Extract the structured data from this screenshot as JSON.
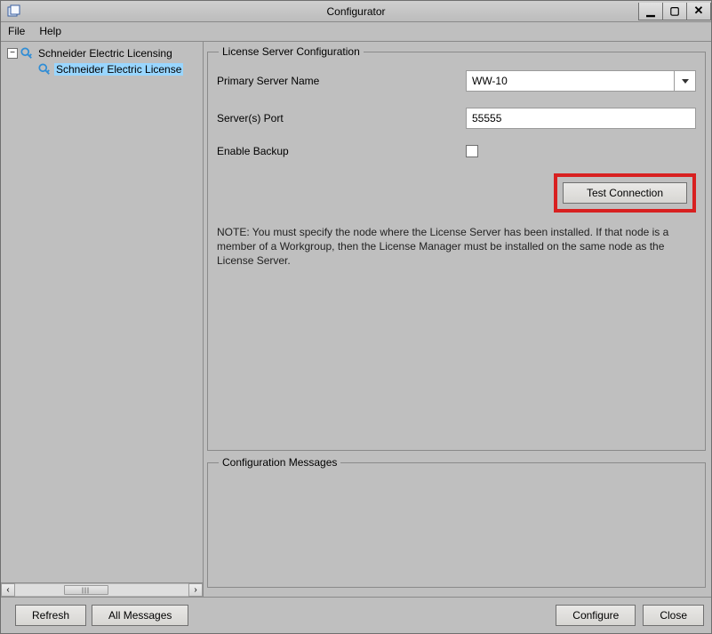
{
  "window": {
    "title": "Configurator"
  },
  "menu": {
    "file": "File",
    "help": "Help"
  },
  "tree": {
    "root_label": "Schneider Electric Licensing",
    "child_label": "Schneider Electric License"
  },
  "config": {
    "group_title": "License Server Configuration",
    "primary_server_label": "Primary Server Name",
    "primary_server_value": "WW-10",
    "port_label": "Server(s) Port",
    "port_value": "55555",
    "backup_label": "Enable Backup",
    "test_button_label": "Test Connection",
    "note": "NOTE: You must specify the node where the License Server has been installed. If that node is a member of a Workgroup, then the License Manager must be installed on the same node as the License Server."
  },
  "messages": {
    "group_title": "Configuration Messages"
  },
  "buttons": {
    "refresh": "Refresh",
    "all_messages": "All Messages",
    "configure": "Configure",
    "close": "Close"
  }
}
